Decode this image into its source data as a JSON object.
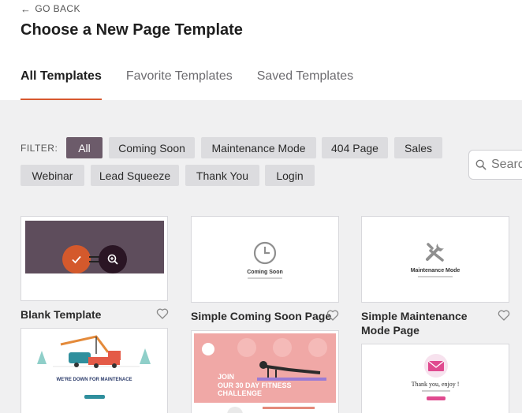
{
  "header": {
    "go_back": "GO BACK",
    "title": "Choose a New Page Template",
    "tabs": [
      "All Templates",
      "Favorite Templates",
      "Saved Templates"
    ]
  },
  "filter": {
    "label": "FILTER:",
    "chips": [
      "All",
      "Coming Soon",
      "Maintenance Mode",
      "404 Page",
      "Sales",
      "Webinar",
      "Lead Squeeze",
      "Thank You",
      "Login"
    ],
    "active": "All"
  },
  "search": {
    "placeholder": "Search"
  },
  "templates": [
    {
      "label": "Blank Template"
    },
    {
      "label": "Simple Coming Soon Page",
      "thumb_caption": "Coming Soon"
    },
    {
      "label": "Simple Maintenance Mode Page",
      "thumb_caption": "Maintenance Mode"
    }
  ],
  "previews": {
    "maintenance_banner": "WE'RE DOWN FOR MAINTENACE",
    "fitness_line1": "JOIN",
    "fitness_line2": "OUR 30 DAY FITNESS CHALLENGE",
    "thank_you": "Thank you, enjoy !"
  },
  "colors": {
    "accent": "#d7582f",
    "chip_active": "#6c5b6a",
    "chip": "#dcdcdf",
    "blank_thumb": "#5e4d5c"
  }
}
